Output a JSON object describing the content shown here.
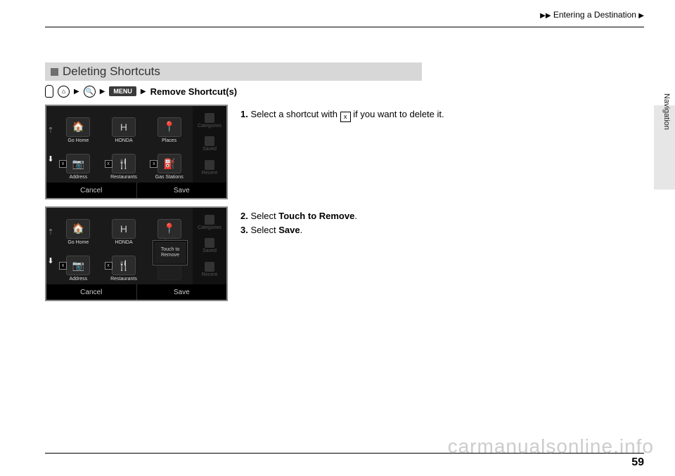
{
  "header": {
    "breadcrumb_prefix": "▶▶",
    "breadcrumb_text": "Entering a Destination",
    "breadcrumb_suffix": "▶"
  },
  "side_tab": {
    "label": "Navigation"
  },
  "section": {
    "title": "Deleting Shortcuts",
    "menu_button": "MENU",
    "action_label": "Remove Shortcut(s)"
  },
  "screenshot1": {
    "tiles": [
      "Go Home",
      "HONDA",
      "Places",
      "Address",
      "Restaurants",
      "Gas Stations"
    ],
    "side_items": [
      "Categories",
      "Saved",
      "Recent"
    ],
    "footer_left": "Cancel",
    "footer_right": "Save"
  },
  "screenshot2": {
    "tiles": [
      "Go Home",
      "HONDA",
      "Places",
      "Address",
      "Restaurants",
      ""
    ],
    "side_items": [
      "Categories",
      "Saved",
      "Recent"
    ],
    "footer_left": "Cancel",
    "footer_right": "Save",
    "popup": "Touch to Remove"
  },
  "steps": {
    "s1_num": "1.",
    "s1_a": "Select a shortcut with ",
    "s1_b": " if you want to delete it.",
    "s2_num": "2.",
    "s2_a": "Select ",
    "s2_b": "Touch to Remove",
    "s2_c": ".",
    "s3_num": "3.",
    "s3_a": "Select ",
    "s3_b": "Save",
    "s3_c": "."
  },
  "watermark": "carmanualsonline.info",
  "page_number": "59"
}
